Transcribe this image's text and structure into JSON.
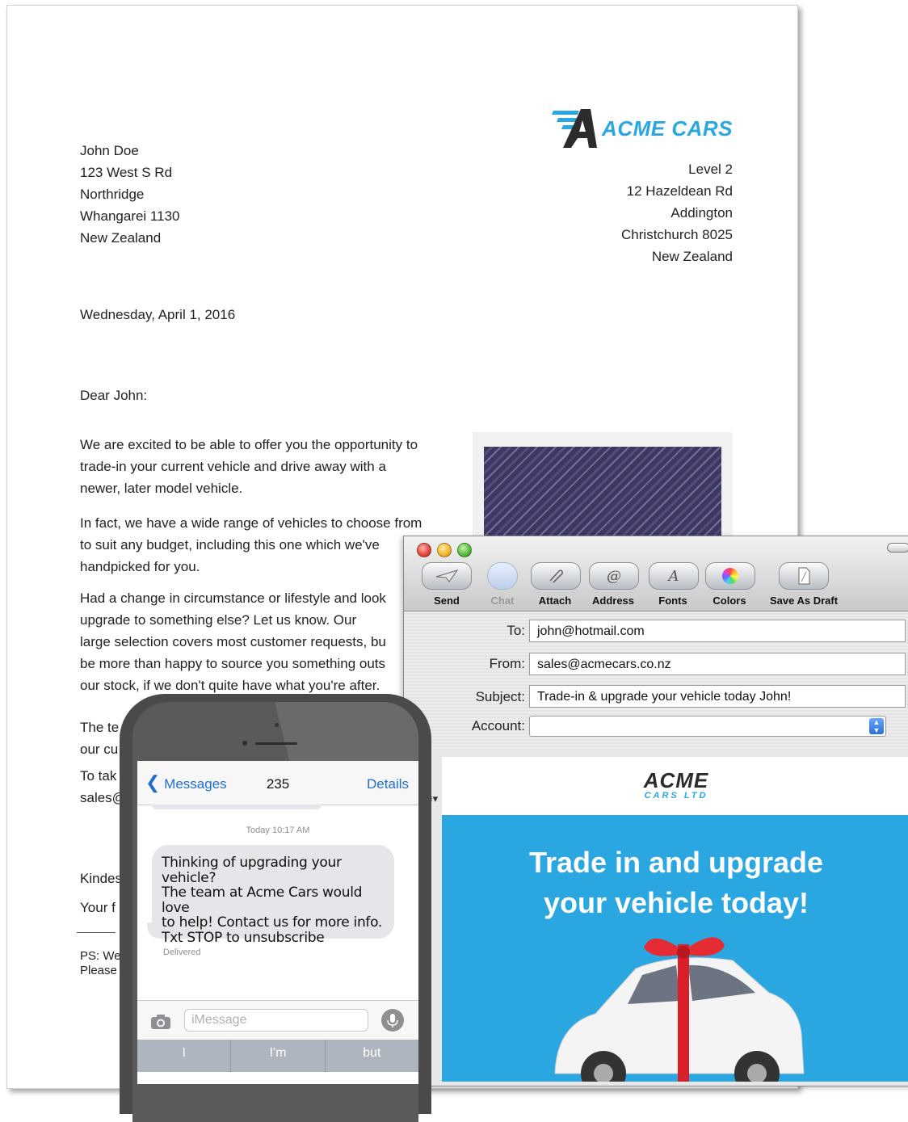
{
  "letter": {
    "brand": "ACME CARS",
    "recipient_lines": [
      "John Doe",
      "123 West S Rd",
      "Northridge",
      "Whangarei 1130",
      "New Zealand"
    ],
    "sender_lines": [
      "Level 2",
      "12 Hazeldean Rd",
      "Addington",
      "Christchurch 8025",
      "New Zealand"
    ],
    "date": "Wednesday, April 1, 2016",
    "salutation": "Dear John:",
    "p1_lines": [
      "We are excited to be able to offer you the opportunity to",
      "trade-in your current vehicle and drive away with a",
      "newer, later model vehicle."
    ],
    "p2_lines": [
      "In fact, we have a wide range of vehicles to choose from",
      "to suit any budget, including this one which we've",
      "handpicked for you."
    ],
    "p3_lines": [
      "Had a change in circumstance or lifestyle and look",
      "upgrade to something else? Let us know. Our",
      "large selection covers most customer requests, bu",
      "be more than happy to source you something outs",
      "our stock, if we don't quite have what you're after."
    ],
    "p4_lines": [
      "The te",
      "our cu"
    ],
    "p5_lines": [
      "To tak",
      "sales@"
    ],
    "sign_off": "Kindes",
    "sign_name": "Your f",
    "ps_lines": [
      "PS: We",
      "Please"
    ]
  },
  "mail": {
    "toolbar": {
      "send": "Send",
      "chat": "Chat",
      "attach": "Attach",
      "address": "Address",
      "fonts": "Fonts",
      "colors": "Colors",
      "save_draft": "Save As Draft"
    },
    "to_label": "To:",
    "to_value": "john@hotmail.com",
    "from_label": "From:",
    "from_value": "sales@acmecars.co.nz",
    "subject_label": "Subject:",
    "subject_value": "Trade-in & upgrade your vehicle today John!",
    "account_label": "Account:",
    "account_value": "",
    "body": {
      "logo_line1": "ACME",
      "logo_line2": "CARS LTD",
      "headline_line1": "Trade in and upgrade",
      "headline_line2": "your vehicle today!"
    }
  },
  "phone": {
    "back_label": "Messages",
    "contact": "235",
    "details": "Details",
    "timestamp": "Today  10:17 AM",
    "message_lines": [
      "Thinking of upgrading your vehicle?",
      "The team at Acme Cars would love",
      "to help! Contact us for more info.",
      "Txt STOP to unsubscribe"
    ],
    "delivered": "Delivered",
    "input_placeholder": "iMessage",
    "predictions": [
      "I",
      "I'm",
      "but"
    ]
  },
  "colors": {
    "brand_blue": "#2aa7e0",
    "ios_blue": "#1f6fd0",
    "bubble_gray": "#e5e5ea"
  }
}
